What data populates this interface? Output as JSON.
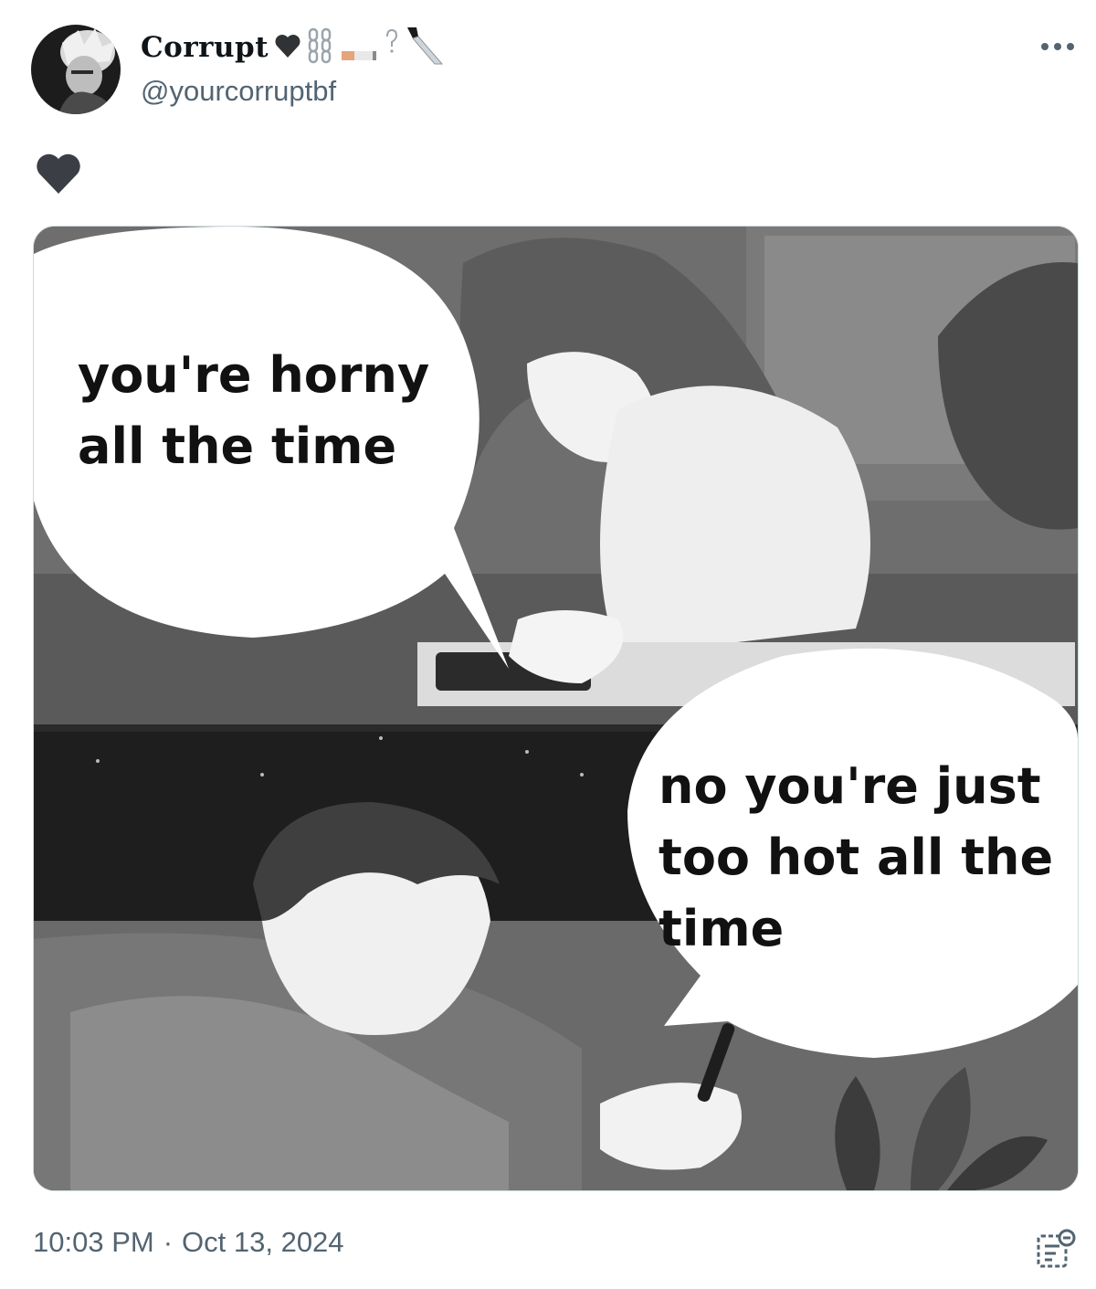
{
  "author": {
    "display_name": "Corrupt",
    "name_emojis": [
      "black-heart",
      "chain",
      "cigarette",
      "question-mark",
      "knife"
    ],
    "handle": "@yourcorruptbf"
  },
  "header": {
    "more_icon": "more-horizontal-icon"
  },
  "tweet": {
    "text_emoji": "black-heart"
  },
  "media": {
    "bubble_top": "you're horny\nall the time",
    "bubble_bottom": "no you're just\ntoo hot all the\ntime"
  },
  "footer": {
    "time": "10:03 PM",
    "separator": "·",
    "date": "Oct 13, 2024",
    "views_icon": "analytics-icon"
  },
  "colors": {
    "text_primary": "#0f1419",
    "text_secondary": "#536471",
    "heart": "#3b3f45"
  }
}
